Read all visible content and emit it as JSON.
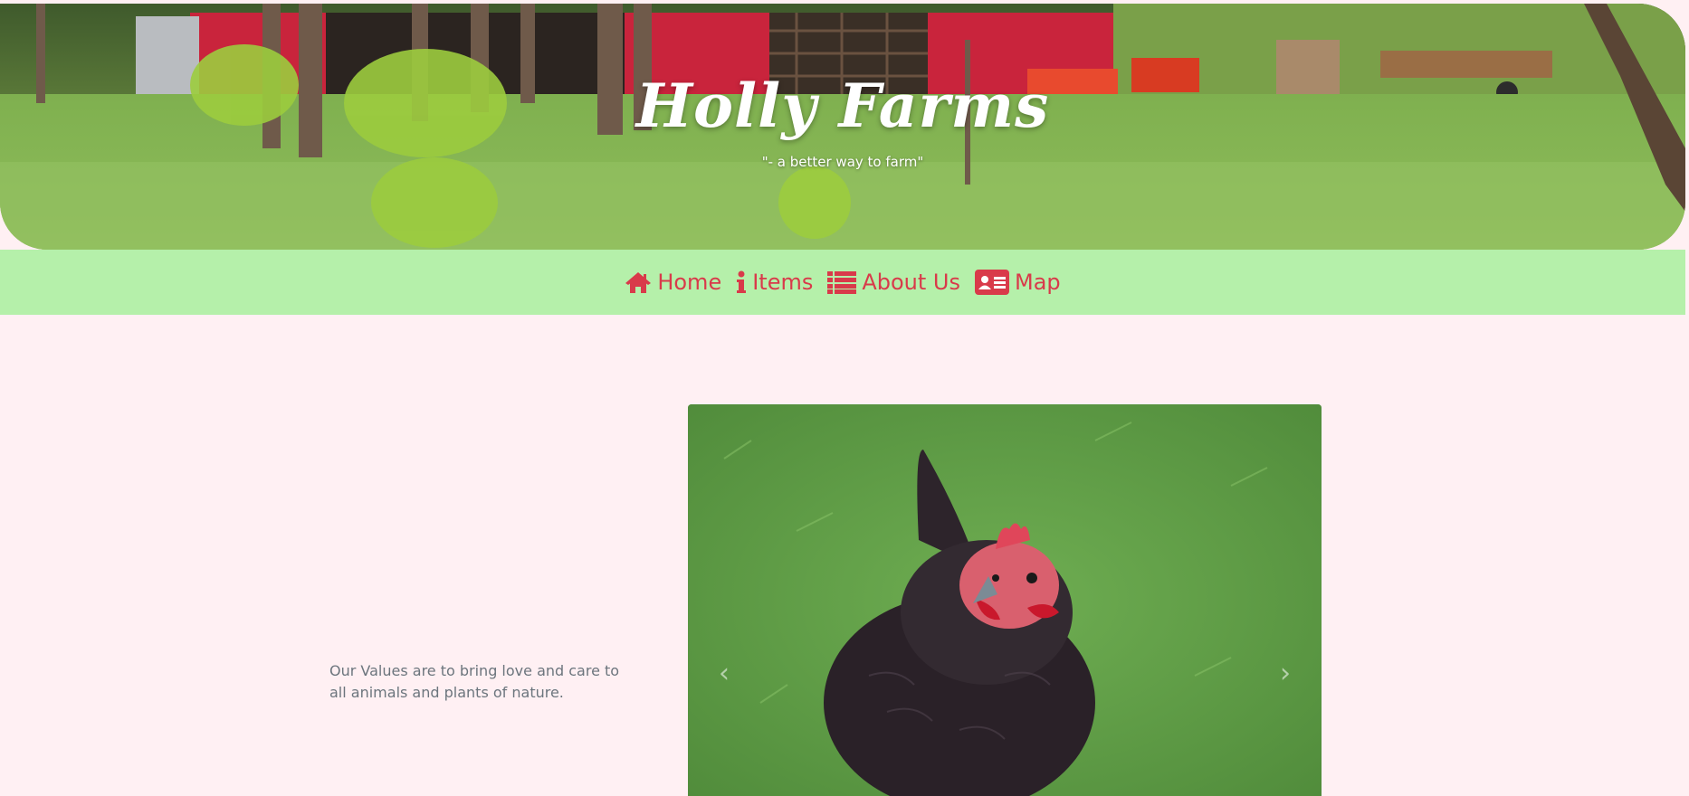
{
  "header": {
    "title": "Holly Farms",
    "tagline": "\"- a better way to farm\""
  },
  "nav": {
    "items": [
      {
        "label": "Home",
        "icon": "home-icon"
      },
      {
        "label": "Items",
        "icon": "info-icon"
      },
      {
        "label": "About Us",
        "icon": "list-icon"
      },
      {
        "label": "Map",
        "icon": "address-card-icon"
      }
    ]
  },
  "main": {
    "values_text": "Our Values are to bring love and care to all animals and plants of nature.",
    "carousel": {
      "prev_icon": "chevron-left-icon",
      "next_icon": "chevron-right-icon",
      "image": "chicken-photo"
    }
  },
  "colors": {
    "page_bg": "#fff0f3",
    "nav_bg": "#b5f0aa",
    "nav_text": "#d93a4a",
    "body_text": "#6c757d"
  }
}
